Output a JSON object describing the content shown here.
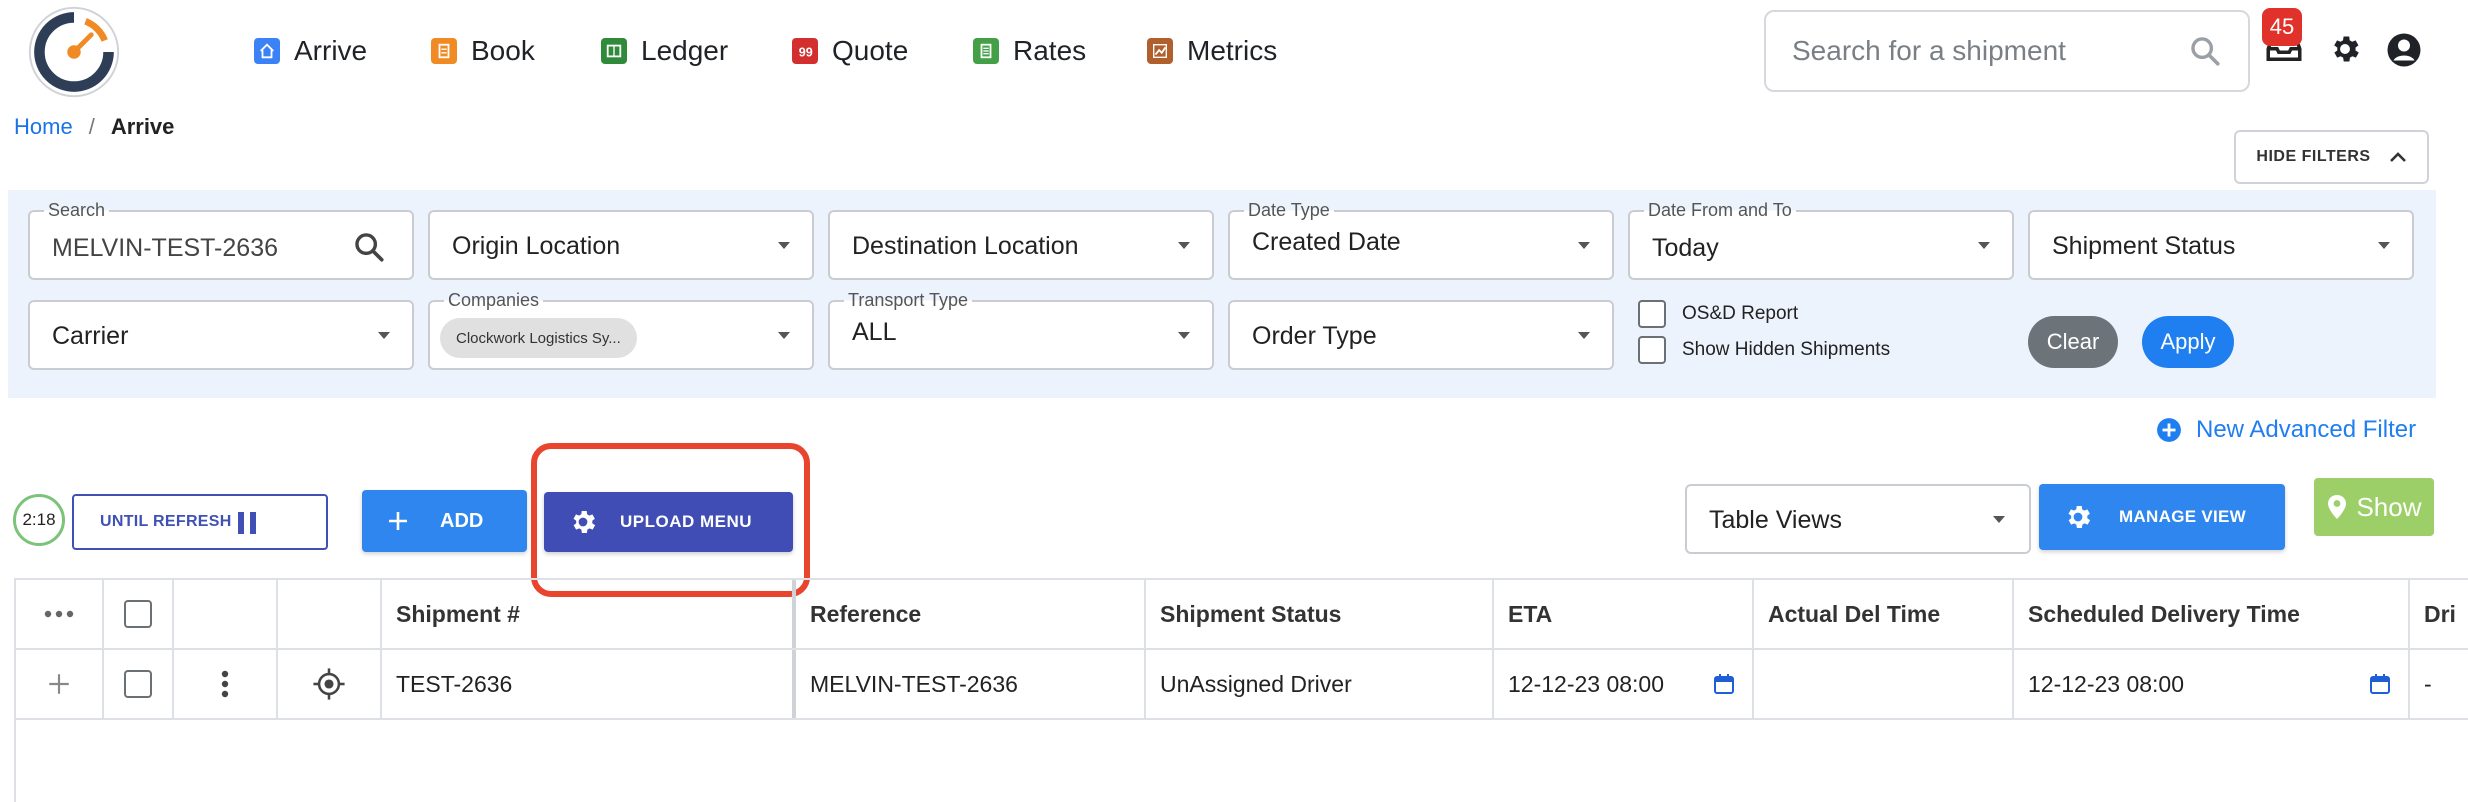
{
  "nav": {
    "items": [
      {
        "label": "Arrive",
        "icon": "home-icon",
        "color": "#3b82f6"
      },
      {
        "label": "Book",
        "icon": "book-icon",
        "color": "#f08a24"
      },
      {
        "label": "Ledger",
        "icon": "ledger-icon",
        "color": "#2f8a3a"
      },
      {
        "label": "Quote",
        "icon": "quote-icon",
        "color": "#d32f2f"
      },
      {
        "label": "Rates",
        "icon": "rates-icon",
        "color": "#43a047"
      },
      {
        "label": "Metrics",
        "icon": "metrics-icon",
        "color": "#b0602c"
      }
    ],
    "search_placeholder": "Search for a shipment",
    "notification_count": "45"
  },
  "breadcrumb": {
    "home": "Home",
    "separator": "/",
    "current": "Arrive"
  },
  "filters": {
    "hide_label": "HIDE FILTERS",
    "search_label": "Search",
    "search_value": "MELVIN-TEST-2636",
    "origin": "Origin Location",
    "destination": "Destination Location",
    "date_type_label": "Date Type",
    "date_type_value": "Created Date",
    "date_range_label": "Date From and To",
    "date_range_value": "Today",
    "shipment_status": "Shipment Status",
    "carrier": "Carrier",
    "companies_label": "Companies",
    "companies_chip": "Clockwork Logistics Sy...",
    "transport_label": "Transport Type",
    "transport_value": "ALL",
    "order_type": "Order Type",
    "osd_report": "OS&D Report",
    "show_hidden": "Show Hidden Shipments",
    "clear": "Clear",
    "apply": "Apply"
  },
  "toolbar": {
    "advanced_filter": "New Advanced Filter",
    "timer": "2:18",
    "until_refresh": "UNTIL REFRESH",
    "add": "ADD",
    "upload_menu": "UPLOAD MENU",
    "table_views": "Table Views",
    "manage_view": "MANAGE VIEW",
    "show": "Show"
  },
  "table": {
    "columns": [
      "Shipment #",
      "Reference",
      "Shipment Status",
      "ETA",
      "Actual Del Time",
      "Scheduled Delivery Time",
      "Dri"
    ],
    "rows": [
      {
        "shipment": "TEST-2636",
        "reference": "MELVIN-TEST-2636",
        "status": "UnAssigned Driver",
        "eta": "12-12-23 08:00",
        "actual_del": "",
        "scheduled": "12-12-23 08:00",
        "driver": "-"
      }
    ]
  }
}
